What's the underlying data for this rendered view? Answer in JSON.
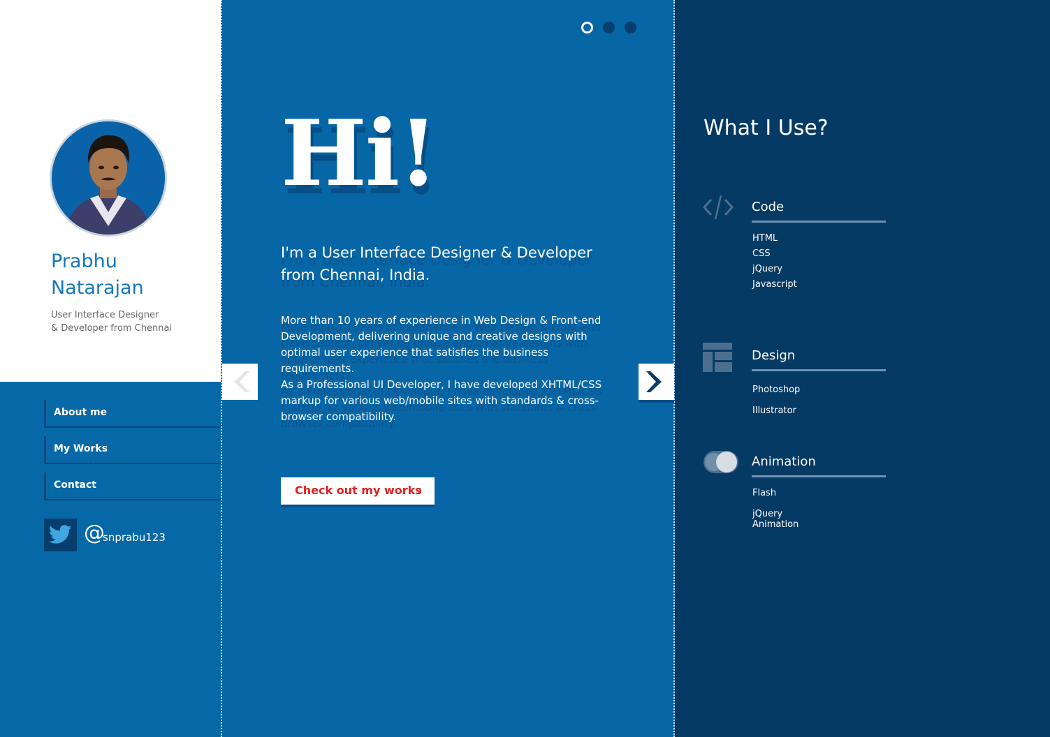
{
  "profile": {
    "name_line1": "Prabhu",
    "name_line2": "Natarajan",
    "role_line1": "User Interface Designer",
    "role_line2": "& Developer from Chennai"
  },
  "nav": {
    "items": [
      {
        "label": "About me"
      },
      {
        "label": "My Works"
      },
      {
        "label": "Contact"
      }
    ]
  },
  "social": {
    "icon": "twitter-icon",
    "at": "@",
    "handle": "snprabu123"
  },
  "slider": {
    "dots": 3,
    "active_dot": 1
  },
  "hero": {
    "greeting": "Hi!",
    "intro_line1": "I'm a User Interface Designer & Developer",
    "intro_line2": "from Chennai, India.",
    "paragraph1": "More than 10 years of experience in Web Design & Front-end Development, delivering unique and creative designs with optimal user experience that satisfies the business requirements.",
    "paragraph2": "As a Professional UI Developer, I have developed XHTML/CSS markup for various web/mobile sites with standards & cross-browser compatibility.",
    "cta_label": "Check out my works",
    "cta_chevron": "›"
  },
  "skills": {
    "title": "What I Use?",
    "groups": [
      {
        "title": "Code",
        "icon": "code-icon",
        "items": [
          "HTML",
          "CSS",
          "jQuery",
          "Javascript"
        ]
      },
      {
        "title": "Design",
        "icon": "layout-icon",
        "items": [
          "Photoshop",
          "Illustrator"
        ]
      },
      {
        "title": "Animation",
        "icon": "toggle-icon",
        "items": [
          "Flash",
          "jQuery Animation"
        ]
      }
    ]
  },
  "colors": {
    "primary_blue": "#0766a6",
    "dark_navy": "#053a64",
    "accent_red": "#e02020",
    "name_blue": "#1577bb"
  }
}
